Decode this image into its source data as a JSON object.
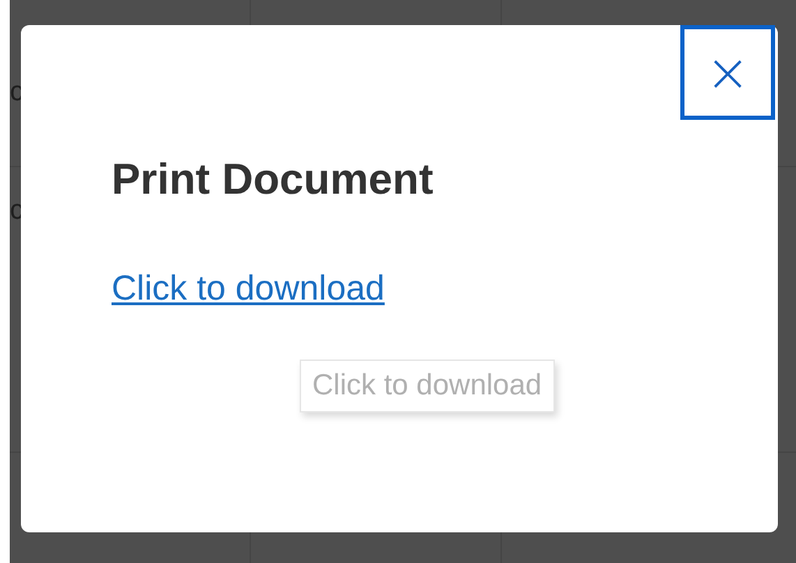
{
  "background_table": {
    "rows": [
      {
        "cells": [
          "c"
        ]
      },
      {
        "cells": [
          "c"
        ]
      }
    ]
  },
  "dialog": {
    "title": "Print Document",
    "link": "Click to download",
    "tooltip": "Click to download",
    "close_button": {
      "label": "×",
      "focused": true
    }
  }
}
